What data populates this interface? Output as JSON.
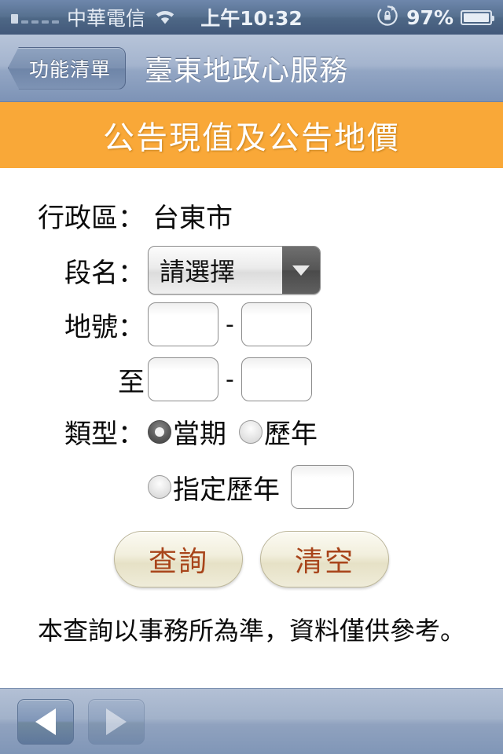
{
  "statusbar": {
    "carrier": "中華電信",
    "time": "上午10:32",
    "battery_percent": "97%",
    "signal_bars_filled": 1,
    "signal_bars_total": 5,
    "wifi_icon": "wifi-icon",
    "rotation_lock_icon": "rotation-lock-icon",
    "battery_icon": "battery-icon"
  },
  "navbar": {
    "back_label": "功能清單",
    "title": "臺東地政心服務"
  },
  "banner": {
    "title": "公告現值及公告地價",
    "color": "#f9a838"
  },
  "form": {
    "district": {
      "label": "行政區：",
      "value": "台東市"
    },
    "section": {
      "label": "段名：",
      "selected": "請選擇",
      "options": [
        "請選擇"
      ]
    },
    "landno": {
      "label": "地號：",
      "main_value": "",
      "sub_value": "",
      "separator": "-"
    },
    "landno_to": {
      "label": "至",
      "main_value": "",
      "sub_value": "",
      "separator": "-"
    },
    "type": {
      "label": "類型：",
      "options": [
        {
          "label": "當期",
          "selected": true
        },
        {
          "label": "歷年",
          "selected": false
        }
      ]
    },
    "specified_year": {
      "label": "指定歷年",
      "selected": false,
      "value": ""
    },
    "buttons": {
      "submit": "查詢",
      "clear": "清空",
      "text_color": "#a8441a"
    },
    "note": "本查詢以事務所為準，資料僅供參考。"
  },
  "toolbar": {
    "back_icon": "triangle-left-icon",
    "forward_icon": "triangle-right-icon",
    "back_enabled": true,
    "forward_enabled": false
  }
}
